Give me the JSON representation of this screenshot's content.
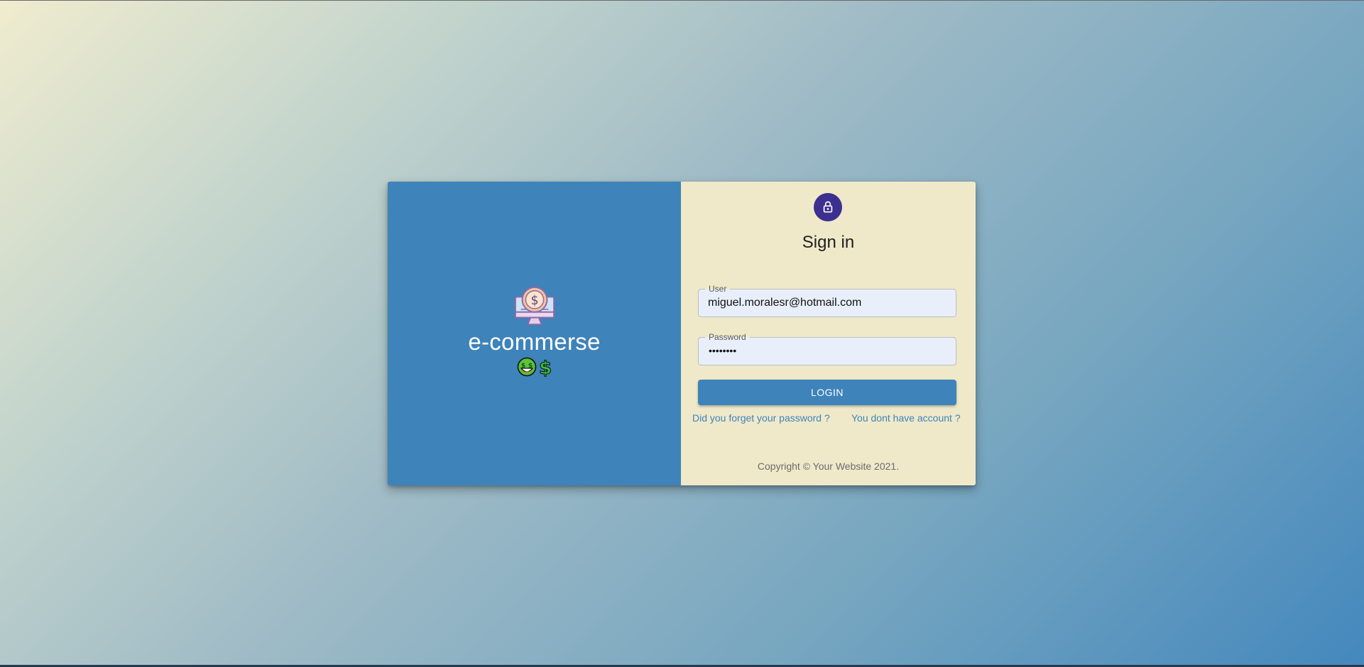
{
  "brand": {
    "name": "e-commerse",
    "logo_icon": "monitor-dollar-icon",
    "emojis": [
      "money-face-emoji",
      "dollar-sign-emoji"
    ]
  },
  "signin": {
    "icon": "lock-icon",
    "title": "Sign in",
    "user": {
      "label": "User",
      "value": "miguel.moralesr@hotmail.com"
    },
    "password": {
      "label": "Password",
      "value": "••••••••"
    },
    "login_label": "LOGIN",
    "forgot_link": "Did you forget your password ?",
    "signup_link": "You dont have account ?",
    "copyright": "Copyright © Your Website 2021."
  },
  "colors": {
    "primary": "#3e83b9",
    "avatar": "#3b2f8f",
    "panel": "#efe9ca",
    "input_bg": "#e8effb"
  }
}
